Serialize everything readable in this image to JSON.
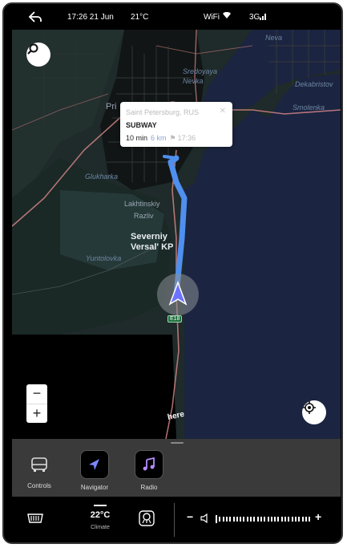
{
  "statusbar": {
    "back_icon": "back-arrow-icon",
    "time_date": "17:26 21 Jun",
    "temperature": "21°C",
    "wifi_label": "WiFi",
    "network_label": "3G"
  },
  "map": {
    "labels": {
      "neva": "Neva",
      "sredoyaya_nevka": "Sredoyaya\nNevka",
      "dekabristov": "Dekabristov",
      "smolenka": "Smolenka",
      "pri": "Pri",
      "glukharka": "Glukharka",
      "lakhtinskiy": "Lakhtinskiy",
      "razliv": "Razliv",
      "severniy": "Severniy\nVersal' KP",
      "yuntolovka": "Yuntolovka",
      "road": "E18",
      "brand": "here"
    },
    "popup": {
      "location": "Saint Petersburg, RUS",
      "name": "SUBWAY",
      "duration": "10 min",
      "distance": "6 km",
      "eta": "17:36"
    },
    "zoom": {
      "minus": "−",
      "plus": "+"
    },
    "route_color": "#4f8fef",
    "water_color": "#1b2440",
    "land_color": "#1f2a2a"
  },
  "dock": {
    "apps": [
      {
        "label": "Controls",
        "icon": "car-front-icon"
      },
      {
        "label": "Navigator",
        "icon": "navigation-arrow-icon"
      },
      {
        "label": "Radio",
        "icon": "music-note-icon"
      }
    ]
  },
  "bottombar": {
    "defrost_icon": "rear-defrost-icon",
    "climate_temp": "22°C",
    "climate_label": "Climate",
    "seat_icon": "heated-seat-icon",
    "volume_minus": "−",
    "volume_plus": "+",
    "volume_level": 0.05
  }
}
